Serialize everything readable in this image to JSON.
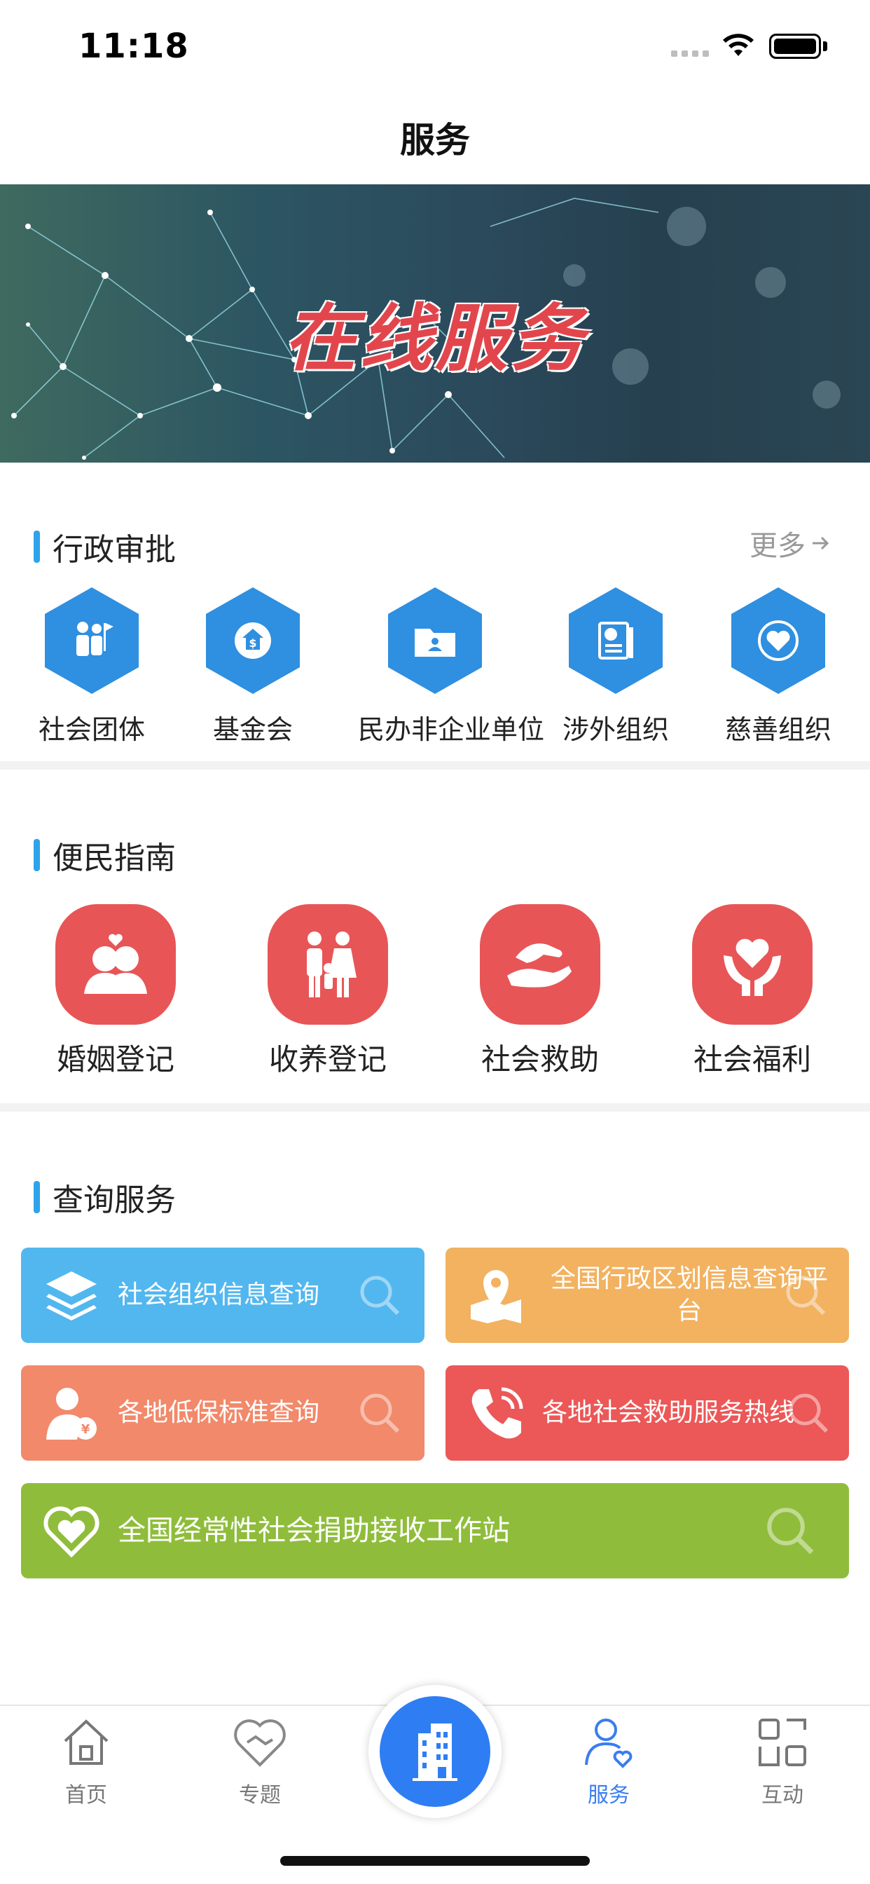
{
  "status_bar": {
    "time": "11:18"
  },
  "nav": {
    "title": "服务"
  },
  "banner": {
    "title": "在线服务"
  },
  "admin": {
    "title": "行政审批",
    "more": "更多",
    "items": [
      {
        "label": "社会团体",
        "icon": "people-flag-icon"
      },
      {
        "label": "基金会",
        "icon": "money-house-icon"
      },
      {
        "label": "民办非企业单位",
        "icon": "folder-person-icon"
      },
      {
        "label": "涉外组织",
        "icon": "globe-document-icon"
      },
      {
        "label": "慈善组织",
        "icon": "heart-icon"
      }
    ]
  },
  "guide": {
    "title": "便民指南",
    "items": [
      {
        "label": "婚姻登记",
        "icon": "couple-heart-icon"
      },
      {
        "label": "收养登记",
        "icon": "family-icon"
      },
      {
        "label": "社会救助",
        "icon": "helping-hands-icon"
      },
      {
        "label": "社会福利",
        "icon": "hands-heart-icon"
      }
    ]
  },
  "query": {
    "title": "查询服务",
    "cards": [
      {
        "label": "社会组织信息查询",
        "color": "#52b7ef",
        "icon": "layers-icon"
      },
      {
        "label": "全国行政区划信息查询平台",
        "color": "#f2b260",
        "icon": "map-pin-icon"
      },
      {
        "label": "各地低保标准查询",
        "color": "#f1896a",
        "icon": "person-coin-icon"
      },
      {
        "label": "各地社会救助服务热线",
        "color": "#ec5757",
        "icon": "phone-icon"
      },
      {
        "label": "全国经常性社会捐助接收工作站",
        "color": "#8fbd3b",
        "icon": "heart-outline-icon"
      }
    ]
  },
  "tabbar": {
    "tabs": [
      {
        "label": "首页",
        "icon": "home-icon"
      },
      {
        "label": "专题",
        "icon": "handshake-heart-icon"
      },
      {
        "label": "服务",
        "icon": "user-heart-icon"
      },
      {
        "label": "互动",
        "icon": "grid-icon"
      }
    ],
    "active_color": "#3a7df0",
    "center_icon": "building-icon"
  }
}
